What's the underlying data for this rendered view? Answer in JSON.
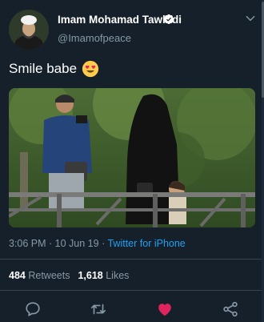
{
  "author": {
    "display_name": "Imam Mohamad Tawhidi",
    "handle": "@Imamofpeace",
    "verified": true
  },
  "tweet": {
    "text": "Smile babe",
    "emoji": "heart-eyes-emoji"
  },
  "meta": {
    "time": "3:06 PM",
    "separator": " · ",
    "date": "10 Jun 19",
    "source": "Twitter for iPhone"
  },
  "stats": {
    "retweets_count": "484",
    "retweets_label": "Retweets",
    "likes_count": "1,618",
    "likes_label": "Likes"
  },
  "actions": [
    {
      "name": "reply",
      "icon": "speech-bubble-icon"
    },
    {
      "name": "retweet",
      "icon": "retweet-icon"
    },
    {
      "name": "like",
      "icon": "heart-icon",
      "active": true
    },
    {
      "name": "share",
      "icon": "share-icon"
    }
  ],
  "colors": {
    "background": "#15202b",
    "secondary_text": "#8899a6",
    "link": "#1da1f2",
    "like_active": "#e0245e",
    "verified": "#ffffff"
  }
}
